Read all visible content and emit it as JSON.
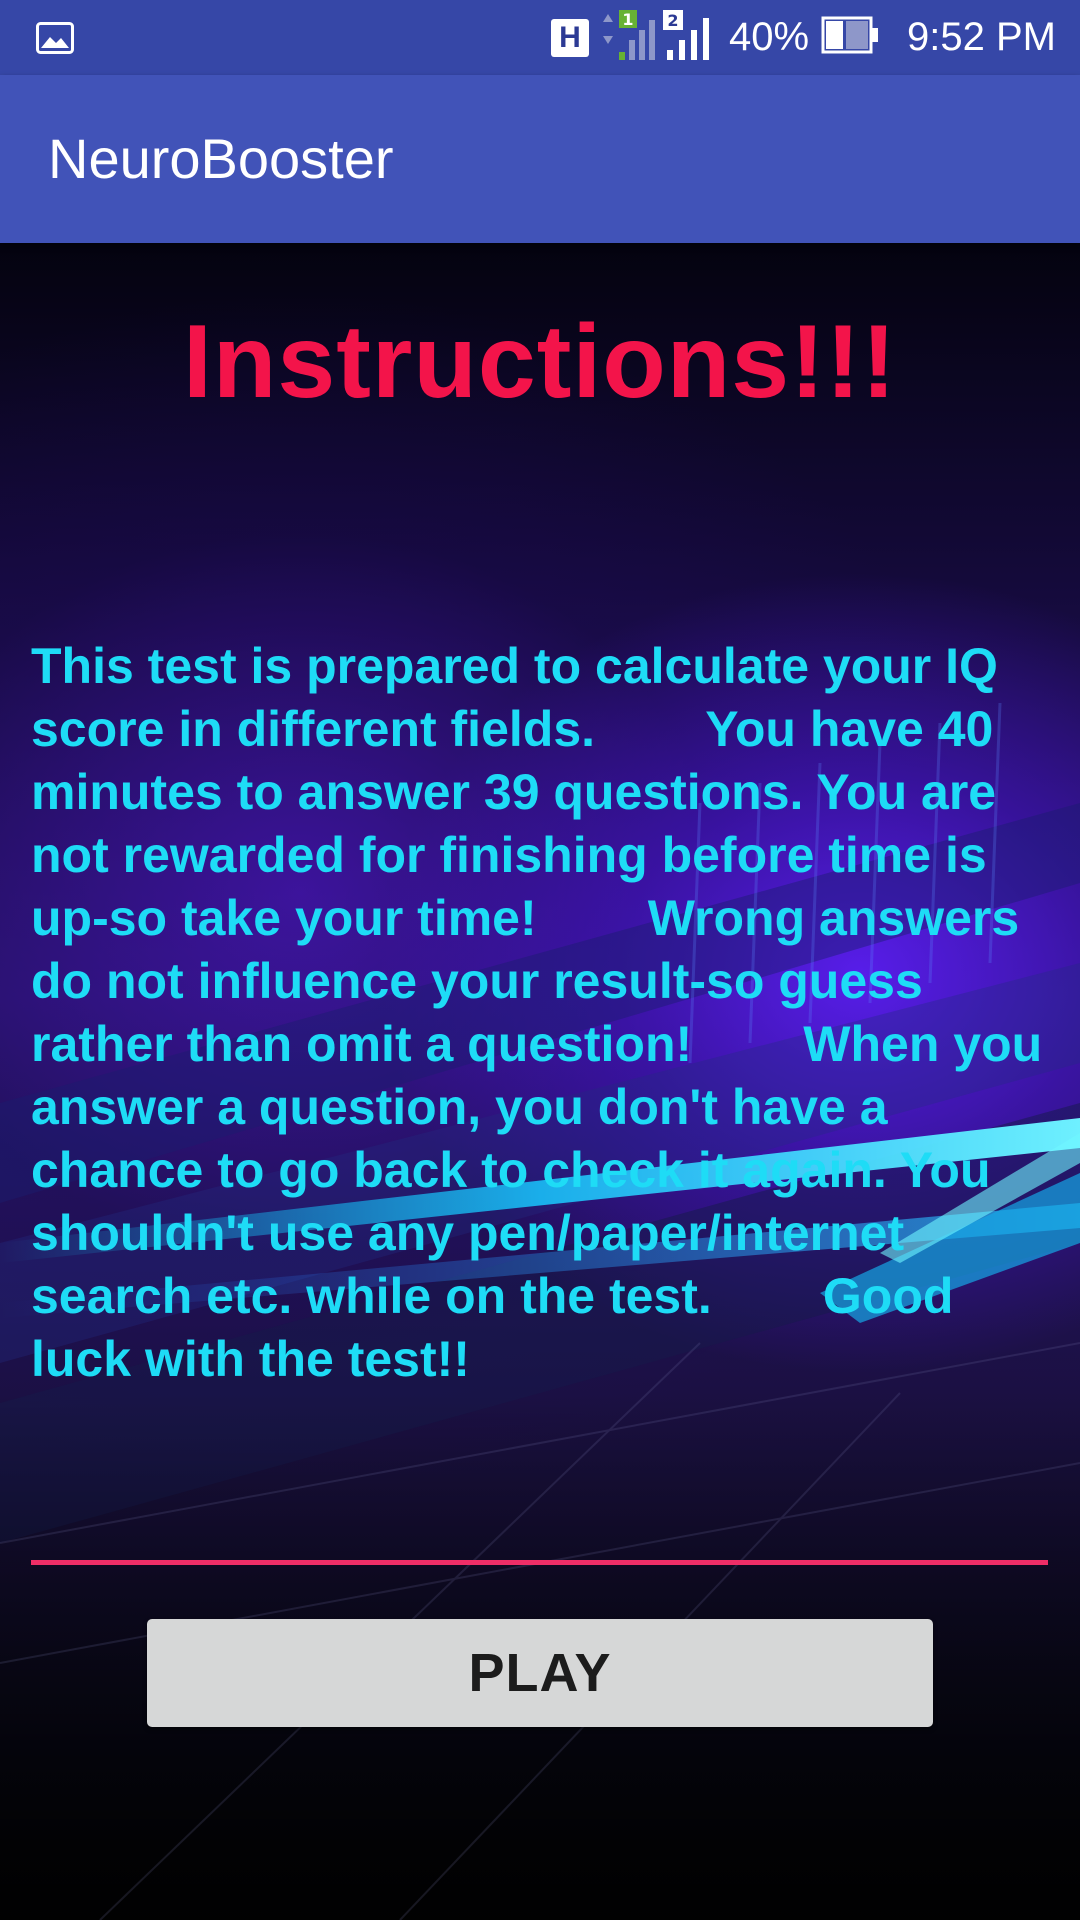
{
  "status_bar": {
    "network_type": "H",
    "sim1_label": "1",
    "sim2_label": "2",
    "battery_percent": "40%",
    "battery_level": 0.4,
    "time": "9:52 PM",
    "icons": [
      "gallery-icon",
      "signal-sim1-icon",
      "signal-sim2-icon",
      "battery-icon"
    ]
  },
  "app_bar": {
    "title": "NeuroBooster"
  },
  "main": {
    "heading": "Instructions!!!",
    "instructions_text": "This test is prepared to calculate your IQ score in different fields.        You have 40 minutes to answer 39 questions. You are not rewarded for finishing before time is up-so take your time!        Wrong answers do not influence your result-so guess rather than omit a question!        When you answer a question, you don't have a chance to go back to check it again. You shouldn't use any pen/paper/internet search etc. while on the test.        Good luck with the test!!",
    "play_label": "PLAY"
  },
  "colors": {
    "status_bar": "#3647a7",
    "app_bar": "#4153b8",
    "heading": "#f3144a",
    "instructions": "#1edcf6",
    "divider": "#ee2e67",
    "play_button": "#d6d7d7"
  }
}
